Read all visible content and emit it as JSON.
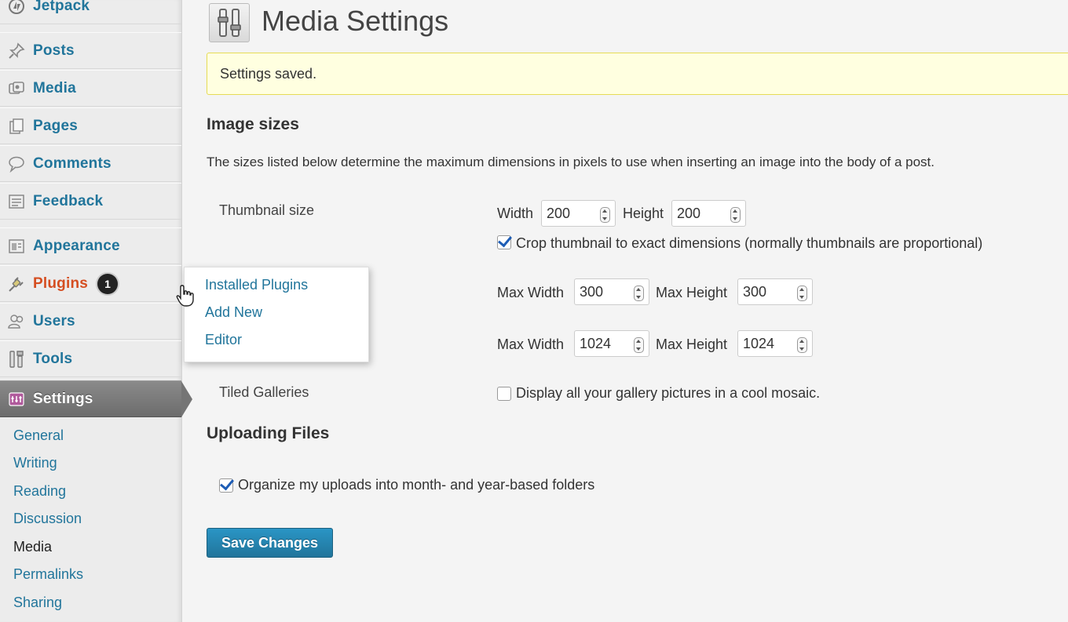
{
  "sidebar": {
    "items": [
      {
        "name": "jetpack",
        "label": "Jetpack",
        "icon": "jetpack-icon"
      },
      {
        "name": "posts",
        "label": "Posts",
        "icon": "pushpin-icon"
      },
      {
        "name": "media",
        "label": "Media",
        "icon": "media-icon"
      },
      {
        "name": "pages",
        "label": "Pages",
        "icon": "pages-icon"
      },
      {
        "name": "comments",
        "label": "Comments",
        "icon": "speech-bubble-icon"
      },
      {
        "name": "feedback",
        "label": "Feedback",
        "icon": "feedback-icon"
      },
      {
        "name": "appearance",
        "label": "Appearance",
        "icon": "appearance-icon"
      },
      {
        "name": "plugins",
        "label": "Plugins",
        "icon": "plug-icon",
        "badge": "1"
      },
      {
        "name": "users",
        "label": "Users",
        "icon": "users-icon"
      },
      {
        "name": "tools",
        "label": "Tools",
        "icon": "tools-icon"
      },
      {
        "name": "settings",
        "label": "Settings",
        "icon": "settings-icon",
        "active": true
      }
    ],
    "settings_submenu": [
      "General",
      "Writing",
      "Reading",
      "Discussion",
      "Media",
      "Permalinks",
      "Sharing"
    ],
    "current_submenu": "Media"
  },
  "flyout": {
    "items": [
      "Installed Plugins",
      "Add New",
      "Editor"
    ]
  },
  "page": {
    "title": "Media Settings",
    "notice": "Settings saved.",
    "image_sizes": {
      "heading": "Image sizes",
      "description": "The sizes listed below determine the maximum dimensions in pixels to use when inserting an image into the body of a post.",
      "thumbnail": {
        "label": "Thumbnail size",
        "width_label": "Width",
        "width": "200",
        "height_label": "Height",
        "height": "200",
        "crop_label": "Crop thumbnail to exact dimensions (normally thumbnails are proportional)",
        "crop_checked": true
      },
      "medium": {
        "max_width_label": "Max Width",
        "max_width": "300",
        "max_height_label": "Max Height",
        "max_height": "300"
      },
      "large": {
        "max_width_label": "Max Width",
        "max_width": "1024",
        "max_height_label": "Max Height",
        "max_height": "1024"
      },
      "tiled": {
        "label": "Tiled Galleries",
        "checkbox_label": "Display all your gallery pictures in a cool mosaic.",
        "checked": false
      }
    },
    "uploading": {
      "heading": "Uploading Files",
      "organize_label": "Organize my uploads into month- and year-based folders",
      "organize_checked": true
    },
    "save_label": "Save Changes"
  },
  "colors": {
    "link": "#21759b",
    "plugins": "#d54e21",
    "notice_bg": "#ffffe0",
    "button": "#21759b"
  }
}
